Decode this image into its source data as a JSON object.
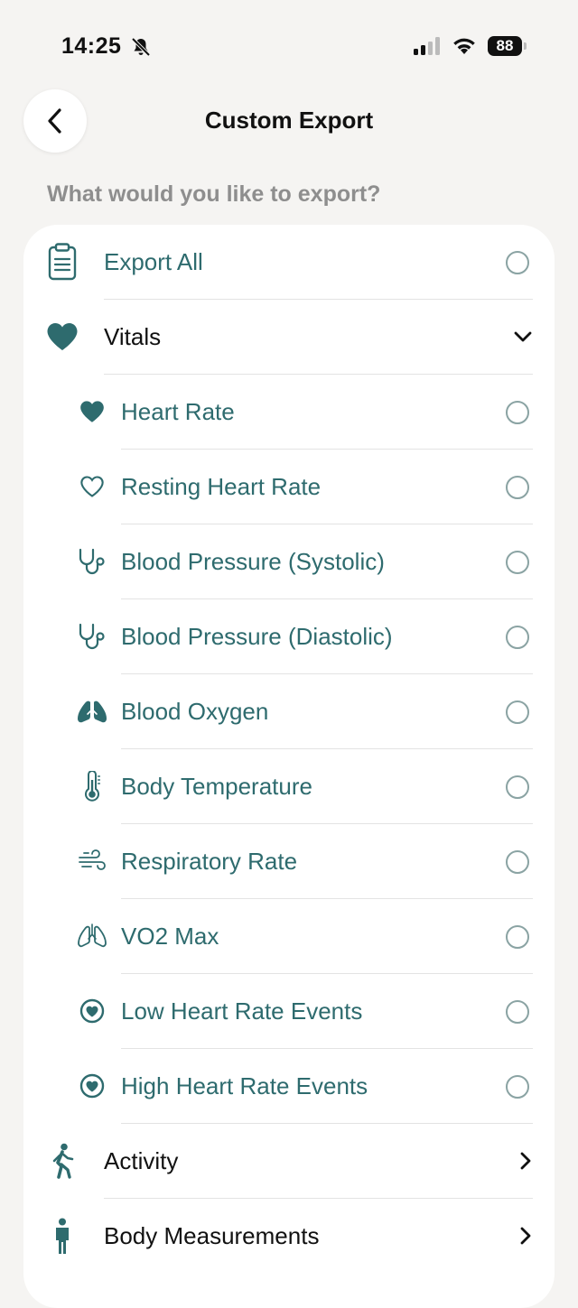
{
  "status_bar": {
    "time": "14:25",
    "battery": "88"
  },
  "header": {
    "title": "Custom Export"
  },
  "prompt": "What would you like to export?",
  "colors": {
    "accent": "#2e6b6e",
    "background": "#f5f4f2",
    "card": "#ffffff",
    "muted_text": "#8e8e8e"
  },
  "export_all": {
    "label": "Export All",
    "icon": "clipboard-icon"
  },
  "vitals": {
    "label": "Vitals",
    "icon": "heart-filled-icon",
    "expanded": true,
    "items": [
      {
        "label": "Heart Rate",
        "icon": "heart-filled-icon"
      },
      {
        "label": "Resting Heart Rate",
        "icon": "heart-outline-icon"
      },
      {
        "label": "Blood Pressure (Systolic)",
        "icon": "stethoscope-icon"
      },
      {
        "label": "Blood Pressure (Diastolic)",
        "icon": "stethoscope-icon"
      },
      {
        "label": "Blood Oxygen",
        "icon": "lungs-filled-icon"
      },
      {
        "label": "Body Temperature",
        "icon": "thermometer-icon"
      },
      {
        "label": "Respiratory Rate",
        "icon": "wind-icon"
      },
      {
        "label": "VO2 Max",
        "icon": "lungs-outline-icon"
      },
      {
        "label": "Low Heart Rate Events",
        "icon": "heart-circle-icon"
      },
      {
        "label": "High Heart Rate Events",
        "icon": "heart-circle-icon"
      }
    ]
  },
  "categories": [
    {
      "label": "Activity",
      "icon": "walking-figure-icon"
    },
    {
      "label": "Body Measurements",
      "icon": "standing-figure-icon"
    }
  ]
}
